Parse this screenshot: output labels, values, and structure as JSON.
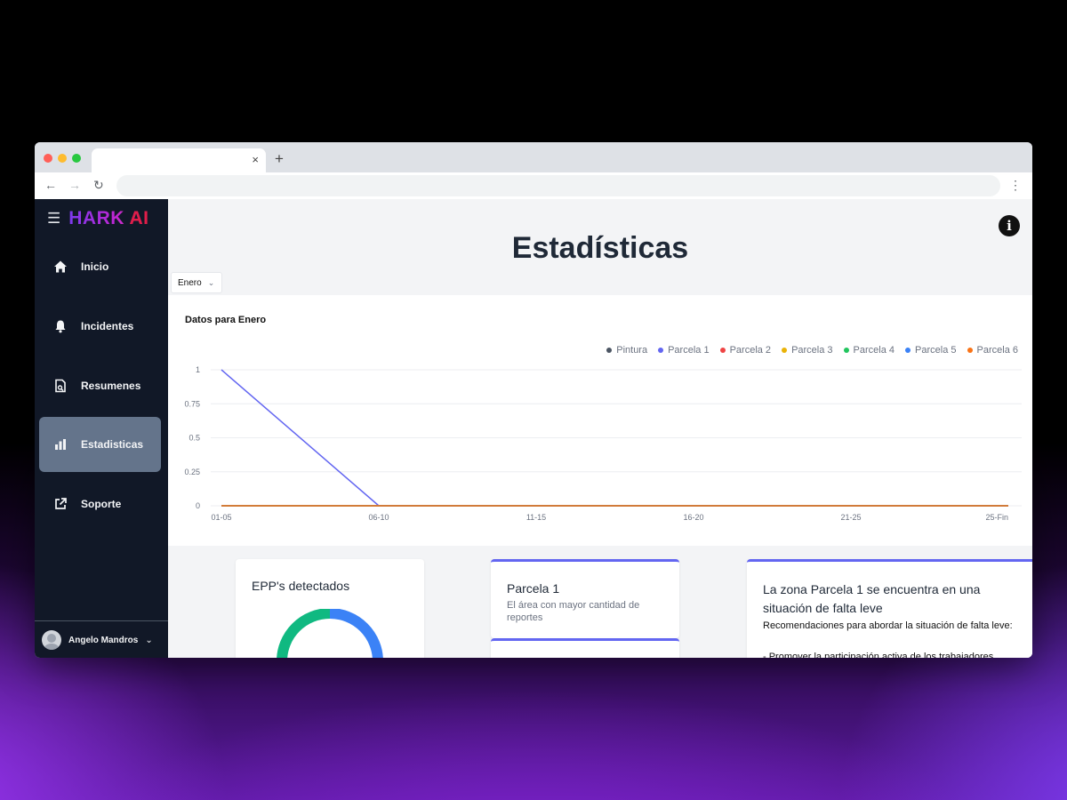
{
  "browser": {
    "tab_close": "×",
    "new_tab": "+"
  },
  "app": {
    "logo_main": "HARK",
    "logo_ai": "AI"
  },
  "sidebar": {
    "items": [
      {
        "label": "Inicio",
        "icon": "home-icon"
      },
      {
        "label": "Incidentes",
        "icon": "bell-icon"
      },
      {
        "label": "Resumenes",
        "icon": "document-icon"
      },
      {
        "label": "Estadisticas",
        "icon": "bar-chart-icon",
        "active": true
      },
      {
        "label": "Soporte",
        "icon": "external-link-icon"
      }
    ],
    "user": {
      "name": "Angelo Mandros"
    }
  },
  "main": {
    "title": "Estadísticas",
    "month_select": "Enero"
  },
  "chart_data": {
    "type": "line",
    "title": "Datos para Enero",
    "categories": [
      "01-05",
      "06-10",
      "11-15",
      "16-20",
      "21-25",
      "25-Fin"
    ],
    "ylim": [
      0,
      1
    ],
    "yticks": [
      "0",
      "0.25",
      "0.5",
      "0.75",
      "1"
    ],
    "grid": true,
    "legend_position": "top-right",
    "series": [
      {
        "name": "Pintura",
        "color": "#4b5563",
        "values": [
          0,
          0,
          0,
          0,
          0,
          0
        ]
      },
      {
        "name": "Parcela 1",
        "color": "#6366f1",
        "values": [
          1,
          0,
          0,
          0,
          0,
          0
        ]
      },
      {
        "name": "Parcela 2",
        "color": "#ef4444",
        "values": [
          0,
          0,
          0,
          0,
          0,
          0
        ]
      },
      {
        "name": "Parcela 3",
        "color": "#eab308",
        "values": [
          0,
          0,
          0,
          0,
          0,
          0
        ]
      },
      {
        "name": "Parcela 4",
        "color": "#22c55e",
        "values": [
          0,
          0,
          0,
          0,
          0,
          0
        ]
      },
      {
        "name": "Parcela 5",
        "color": "#3b82f6",
        "values": [
          0,
          0,
          0,
          0,
          0,
          0
        ]
      },
      {
        "name": "Parcela 6",
        "color": "#f97316",
        "values": [
          0,
          0,
          0,
          0,
          0,
          0
        ]
      }
    ]
  },
  "cards": {
    "epp": {
      "title": "EPP's detectados"
    },
    "parcela": {
      "title": "Parcela 1",
      "subtitle": "El área con mayor cantidad de reportes"
    },
    "zona": {
      "title": "La zona Parcela 1 se encuentra en una situación de falta leve",
      "intro": "Recomendaciones para abordar la situación de falta leve:",
      "bullet1": "- Promover la participación activa de los trabajadores"
    }
  }
}
